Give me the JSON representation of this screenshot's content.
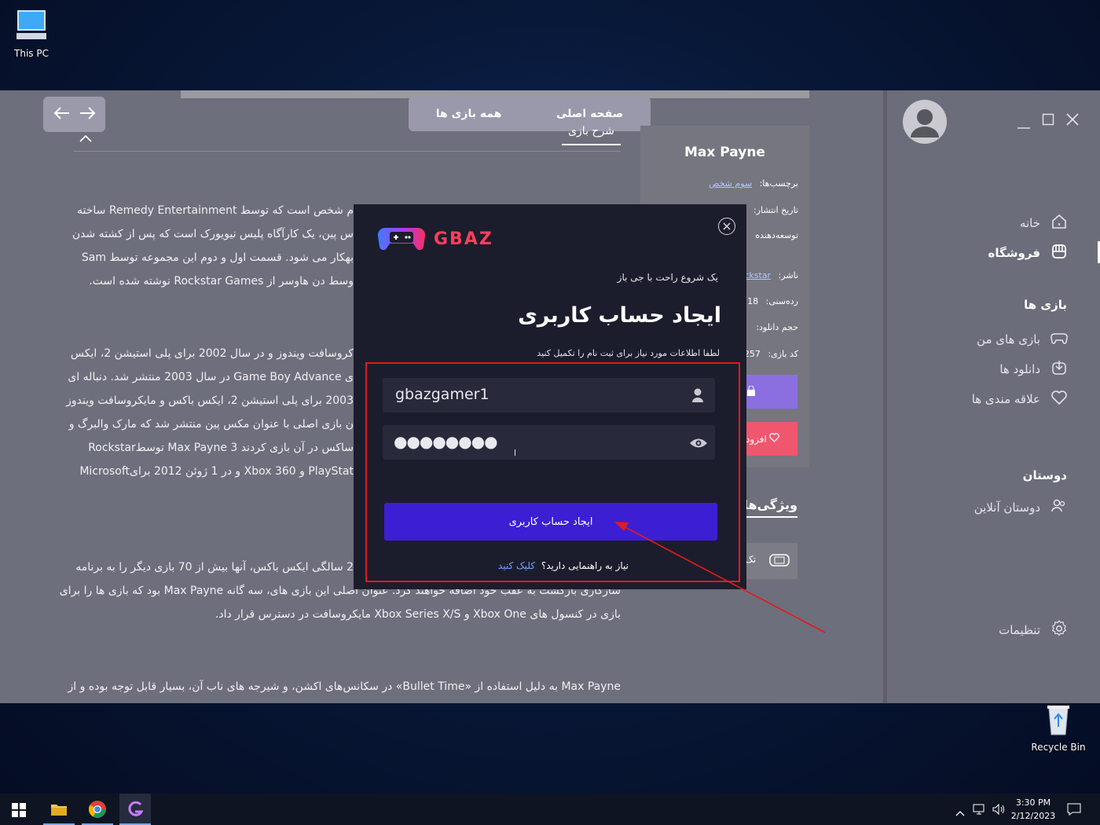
{
  "desktop": {
    "this_pc_label": "This PC",
    "recycle_bin_label": "Recycle Bin"
  },
  "sidebar": {
    "home": "خانه",
    "store": "فروشگاه",
    "games_section": "بازی ها",
    "my_games": "بازی های من",
    "downloads": "دانلود ها",
    "favorites": "علاقه مندی ها",
    "friends_section": "دوستان",
    "online_friends": "دوستان آنلاین",
    "settings": "تنظیمات"
  },
  "topnav": {
    "home_tab": "صفحه اصلی",
    "all_games_tab": "همه بازی ها",
    "description_tab": "شرح بازی"
  },
  "game": {
    "title": "Max Payne",
    "tags_label": "برچسب‌ها:",
    "tags_value": "سوم شخص",
    "release_label": "تاریخ انتشار:",
    "developer_label": "توسعه‌دهنده",
    "publisher_label": "ناشر:",
    "publisher_value": "ockstar",
    "age_label": "رده‌سنی:",
    "age_value": "18+",
    "size_label": "حجم دانلود:",
    "code_label": "کد بازی:",
    "code_value": "1257",
    "add_button": "افزود",
    "features_title": "ویژگی‌ها",
    "features_item": "تک"
  },
  "description": {
    "l1": "م شخص است که توسط Remedy Entertainment ساخته",
    "l2": "س پین، یک کارآگاه پلیس نیویورک است که پس از کشته شدن",
    "l3": "بهکار می شود. قسمت اول و دوم این مجموعه توسط Sam",
    "l4": "وسط دن هاوسر از Rockstar Games نوشته شده است.",
    "l5": "کروسافت ویندوز و در سال 2002 برای پلی استیشن 2، ایکس",
    "l6": "ی Game Boy Advance در سال 2003 منتشر شد. دنباله ای",
    "l7": "2003 برای پلی استیشن 2، ایکس باکس و مایکروسافت ویندوز",
    "l8": "ن بازی اصلی با عنوان مکس پین منتشر شد که مارک والبرگ و",
    "l9": "ساکس در آن بازی کردند Max Payne 3 توسطRockstar",
    "l10": "PlayStat و Xbox 360 و در 1 ژوئن 2012 برایMicrosoft",
    "l11": "2 سالگی ایکس باکس، آنها بیش از 70 بازی دیگر را به برنامه",
    "l12": "سازگاری بازگشت به عقب خود اضافه خواهند کرد. عنوان اصلی این بازی های، سه گانه Max Payne بود که بازی ها را برای",
    "l13": "بازی در کنسول های Xbox One و Xbox Series X/S مایکروسافت در دسترس قرار داد.",
    "l14": "Max Payne به دلیل استفاده از «Bullet Time» در سکانس‌های اکشن، و شیرجه های ناب آن، بسیار قابل توجه بوده و از"
  },
  "modal": {
    "logo_text": "GBAZ",
    "tagline": "یک شروع راحت با جی باز",
    "title": "ایجاد حساب کاربری",
    "subtitle": "لطفا اطلاعات مورد نیاز برای ثبت نام را تکمیل کنید",
    "username_value": "gbazgamer1",
    "password_value": "●●●●●●●●",
    "submit_label": "ایجاد حساب کاربری",
    "help_text": "نیاز به راهنمایی دارید؟",
    "help_link": "کلیک کنید"
  },
  "taskbar": {
    "time": "3:30 PM",
    "date": "2/12/2023"
  },
  "colors": {
    "accent": "#3d1fd3",
    "highlight": "#e21a1a",
    "purple_button": "#8b6fe0",
    "red_button": "#f0566e"
  }
}
